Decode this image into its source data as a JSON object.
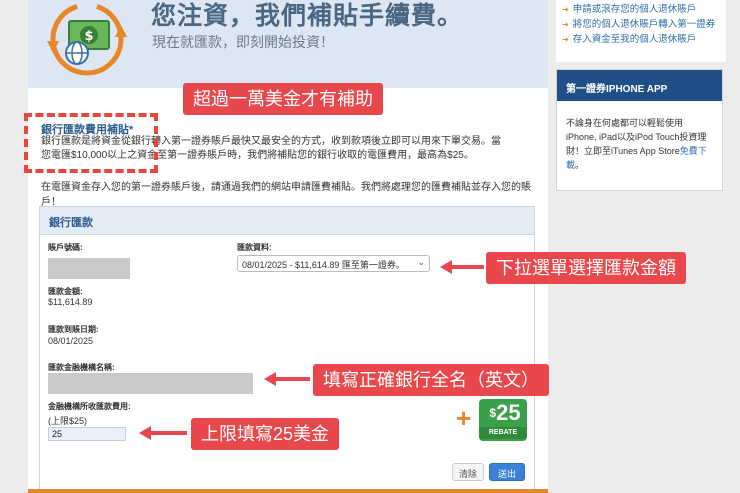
{
  "hero": {
    "title": "您注資，我們補貼手續費。",
    "subtitle": "現在就匯款，即刻開始投資！"
  },
  "fee_section": {
    "title": "銀行匯款費用補貼*",
    "description": "銀行匯款是將資金從銀行轉入第一證券賬戶最快又最安全的方式，收到款項後立即可以用來下單交易。當您電匯$10,000以上之資金至第一證券賬戶時，我們將補貼您的銀行收取的電匯費用，最高為$25。",
    "note": "在電匯資金存入您的第一證券賬戶後，請通過我們的網站申請匯費補貼。我們將處理您的匯費補貼並存入您的賬戶！"
  },
  "form": {
    "header": "銀行匯款",
    "account_label": "賬戶號碼:",
    "wire_info_label": "匯款資料:",
    "wire_info_value": "08/01/2025 - $11,614.89 匯至第一證券。",
    "amount_label": "匯款金額:",
    "amount_value": "$11,614.89",
    "date_label": "匯款到賬日期:",
    "date_value": "08/01/2025",
    "bank_name_label": "匯款金融機構名稱:",
    "fee_label": "金融機構所收匯款費用:",
    "fee_hint": "(上限$25)",
    "fee_value": "25",
    "clear_button": "清除",
    "submit_button": "送出"
  },
  "rebate_badge": {
    "amount": "25",
    "currency": "$",
    "label": "REBATE"
  },
  "callouts": {
    "over_10k": "超過一萬美金才有補助",
    "select_amount": "下拉選單選擇匯款金額",
    "bank_name": "填寫正確銀行全名（英文）",
    "fee_limit": "上限填寫25美金"
  },
  "sidebar": {
    "links": [
      "申請或滾存您的個人退休賬戶",
      "將您的個人退休賬戶轉入第一證券",
      "存入資金至我的個人退休賬戶"
    ],
    "app_title": "第一證券IPHONE APP",
    "app_text": "不論身在何處都可以輕鬆使用iPhone, iPad以及iPod Touch投資理財！立即至iTunes App Store",
    "app_link": "免費下載",
    "app_end": "。"
  },
  "colors": {
    "callout": "#e8474b",
    "accent_orange": "#e8862a",
    "rebate_green": "#3aa04a",
    "link_blue": "#2f6ea8",
    "header_navy": "#1f4f86"
  }
}
